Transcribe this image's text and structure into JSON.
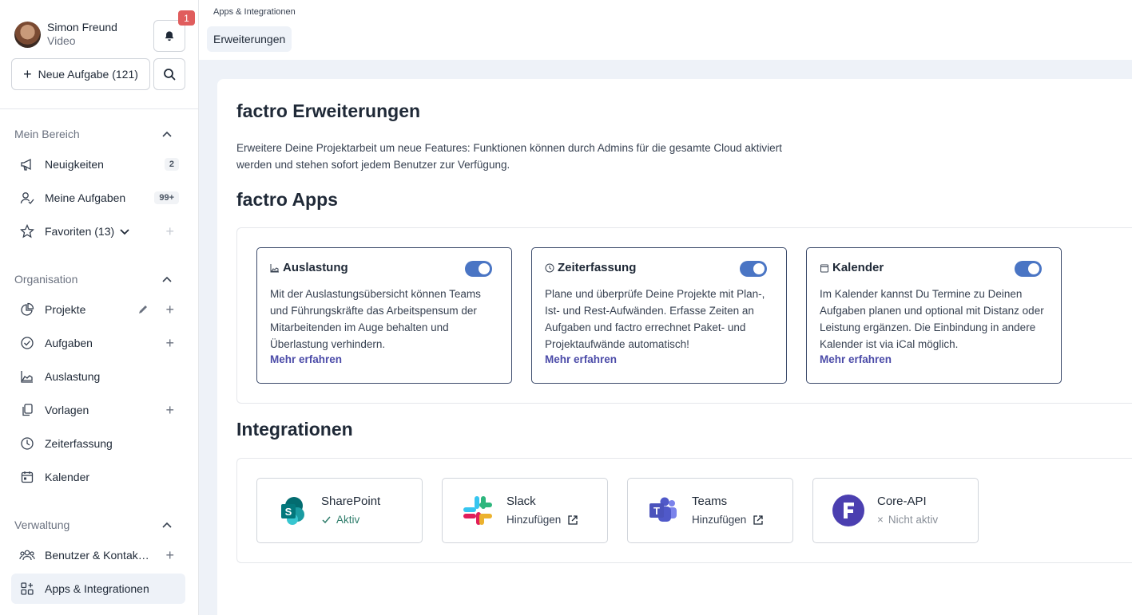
{
  "user": {
    "name": "Simon Freund",
    "role": "Video"
  },
  "notifications": {
    "count": "1"
  },
  "new_task": {
    "label": "Neue Aufgabe (121)"
  },
  "sections": {
    "mein_bereich": "Mein Bereich",
    "organisation": "Organisation",
    "verwaltung": "Verwaltung"
  },
  "nav": {
    "neuigkeiten": {
      "label": "Neuigkeiten",
      "count": "2"
    },
    "aufgaben_mein": {
      "label": "Meine Aufgaben",
      "count": "99+"
    },
    "favoriten": {
      "label": "Favoriten (13)"
    },
    "projekte": {
      "label": "Projekte"
    },
    "aufgaben": {
      "label": "Aufgaben"
    },
    "auslastung": {
      "label": "Auslastung"
    },
    "vorlagen": {
      "label": "Vorlagen"
    },
    "zeiterfassung": {
      "label": "Zeiterfassung"
    },
    "kalender": {
      "label": "Kalender"
    },
    "benutzer": {
      "label": "Benutzer & Kontak…"
    },
    "apps": {
      "label": "Apps & Integrationen"
    }
  },
  "header": {
    "breadcrumb": "Apps & Integrationen",
    "tab": "Erweiterungen"
  },
  "page": {
    "title": "factro Erweiterungen",
    "intro": "Erweitere Deine Projektarbeit um neue Features: Funktionen können durch Admins für die gesamte Cloud aktiviert werden und stehen sofort jedem Benutzer zur Verfügung.",
    "apps_title": "factro Apps",
    "integrations_title": "Integrationen"
  },
  "apps": [
    {
      "title": "Auslastung",
      "enabled": true,
      "desc": "Mit der Auslastungsübersicht können Teams und Führungskräfte das Arbeitspensum der Mitarbeitenden im Auge behalten und Überlastung verhindern.",
      "more": "Mehr erfahren"
    },
    {
      "title": "Zeiterfassung",
      "enabled": true,
      "desc": "Plane und überprüfe Deine Projekte mit Plan-, Ist- und Rest-Aufwänden. Erfasse Zeiten an Aufgaben und factro errechnet Paket- und Projektaufwände automatisch!",
      "more": "Mehr erfahren"
    },
    {
      "title": "Kalender",
      "enabled": true,
      "desc": "Im Kalender kannst Du Termine zu Deinen Aufgaben planen und optional mit Distanz oder Leistung ergänzen. Die Einbindung in andere Kalender ist via iCal möglich.",
      "more": "Mehr erfahren"
    }
  ],
  "integrations": [
    {
      "name": "SharePoint",
      "status": "Aktiv"
    },
    {
      "name": "Slack",
      "status": "Hinzufügen"
    },
    {
      "name": "Teams",
      "status": "Hinzufügen"
    },
    {
      "name": "Core-API",
      "status": "Nicht aktiv"
    }
  ],
  "colors": {
    "accent": "#4a75c4",
    "link": "#4b4ba8",
    "active_bg": "#eef2f8",
    "badge": "#e05d5d"
  }
}
